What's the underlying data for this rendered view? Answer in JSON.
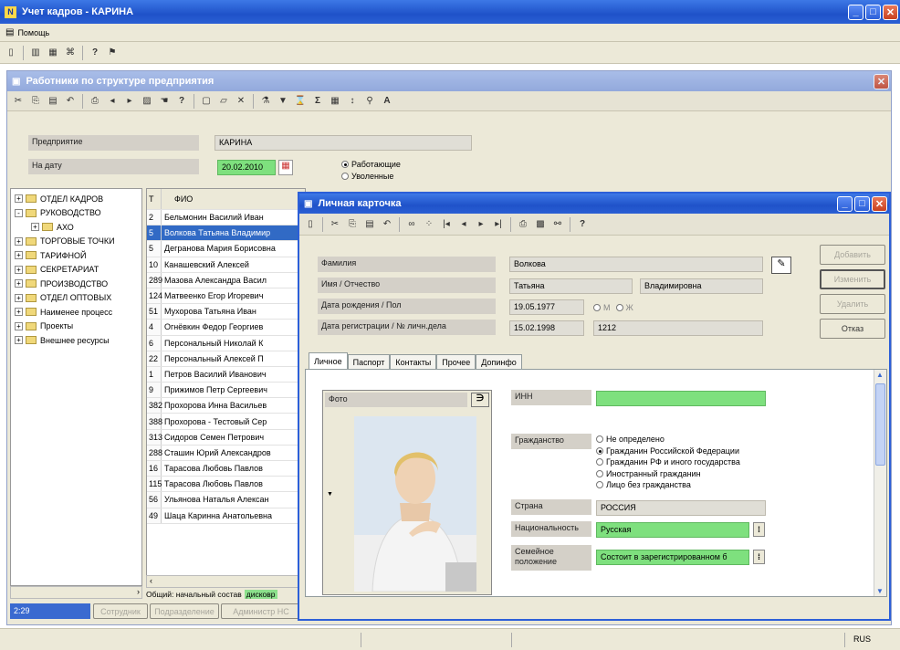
{
  "app": {
    "title": "Учет кадров - КАРИНА",
    "menu_help": "Помощь"
  },
  "staff_window": {
    "title": "Работники по структуре предприятия",
    "company_label": "Предприятие",
    "company_value": "КАРИНА",
    "date_label": "На дату",
    "date_value": "20.02.2010",
    "filter_options": [
      "Работающие",
      "Уволенные"
    ],
    "filter_selected": "Работающие",
    "tree": [
      {
        "label": "ОТДЕЛ КАДРОВ",
        "level": 0,
        "expander": "+"
      },
      {
        "label": "РУКОВОДСТВО",
        "level": 0,
        "expander": "-"
      },
      {
        "label": "АХО",
        "level": 1,
        "expander": "+"
      },
      {
        "label": "ТОРГОВЫЕ ТОЧКИ",
        "level": 0,
        "expander": "+"
      },
      {
        "label": "ТАРИФНОЙ",
        "level": 0,
        "expander": "+"
      },
      {
        "label": "СЕКРЕТАРИАТ",
        "level": 0,
        "expander": "+"
      },
      {
        "label": "ПРОИЗВОДСТВО",
        "level": 0,
        "expander": "+"
      },
      {
        "label": "ОТДЕЛ ОПТОВЫХ",
        "level": 0,
        "expander": "+"
      },
      {
        "label": "Наименее процесс",
        "level": 0,
        "expander": "+"
      },
      {
        "label": "Проекты",
        "level": 0,
        "expander": "+"
      },
      {
        "label": "Внешнее ресурсы",
        "level": 0,
        "expander": "+"
      }
    ],
    "table_header": {
      "num": "Т",
      "name": "ФИО"
    },
    "rows": [
      {
        "num": "2",
        "name": "Бельмонин Василий Иван"
      },
      {
        "num": "5",
        "name": "Волкова Татьяна Владимир"
      },
      {
        "num": "5",
        "name": "Дегранова Мария Борисовна"
      },
      {
        "num": "10",
        "name": "Канашевский Алексей"
      },
      {
        "num": "289",
        "name": "Мазова Александра Васил"
      },
      {
        "num": "124",
        "name": "Матвеенко Егор Игоревич"
      },
      {
        "num": "51",
        "name": "Мухорова Татьяна Иван"
      },
      {
        "num": "4",
        "name": "Огнёвкин Федор Георгиев"
      },
      {
        "num": "6",
        "name": "Персональный Николай К"
      },
      {
        "num": "22",
        "name": "Персональный Алексей П"
      },
      {
        "num": "1",
        "name": "Петров Василий Иванович"
      },
      {
        "num": "9",
        "name": "Прижимов Петр Сергеевич"
      },
      {
        "num": "382",
        "name": "Прохорова Инна Васильев"
      },
      {
        "num": "388",
        "name": "Прохорова - Тестовый Сер"
      },
      {
        "num": "313",
        "name": "Сидоров Семен Петрович"
      },
      {
        "num": "288",
        "name": "Сташин Юрий Александров"
      },
      {
        "num": "16",
        "name": "Тарасова Любовь Павлов"
      },
      {
        "num": "115",
        "name": "Тарасова Любовь Павлов"
      },
      {
        "num": "56",
        "name": "Ульянова Наталья Алексан"
      },
      {
        "num": "49",
        "name": "Шаца Каринна Анатольевна"
      }
    ],
    "selected_row": 1,
    "status_count": "2:29",
    "bottom_buttons": [
      "Сотрудник",
      "Подразделение",
      "Администр НС"
    ],
    "footer_text": "Общий: начальный состав",
    "footer_badge": "дисковр"
  },
  "card_window": {
    "title": "Личная карточка",
    "labels": {
      "surname": "Фамилия",
      "name": "Имя / Отчество",
      "birth": "Дата рождения / Пол",
      "reg": "Дата регистрации / № личн.дела"
    },
    "values": {
      "surname": "Волкова",
      "first_name": "Татьяна",
      "patronymic": "Владимировна",
      "birth_date": "19.05.1977",
      "gender_m": "М",
      "gender_f": "Ж",
      "reg_date": "15.02.1998",
      "file_no": "1212"
    },
    "buttons": [
      "Добавить",
      "Изменить",
      "Удалить",
      "Отказ"
    ],
    "tabs": [
      "Личное",
      "Паспорт",
      "Контакты",
      "Прочее",
      "Допинфо"
    ],
    "active_tab": 0,
    "photo_label": "Фото",
    "inn_label": "ИНН",
    "inn_value": "",
    "citizenship_label": "Гражданство",
    "citizenship_options": [
      "Не определено",
      "Гражданин Российской Федерации",
      "Гражданин РФ и иного государства",
      "Иностранный гражданин",
      "Лицо без гражданства"
    ],
    "citizenship_selected": 1,
    "country_label": "Страна",
    "country_value": "РОССИЯ",
    "nationality_label": "Национальность",
    "nationality_value": "Русская",
    "marital_label": "Семейное положение",
    "marital_value": "Состоит в зарегистрированном б"
  },
  "statusbar": {
    "lang": "RUS"
  }
}
